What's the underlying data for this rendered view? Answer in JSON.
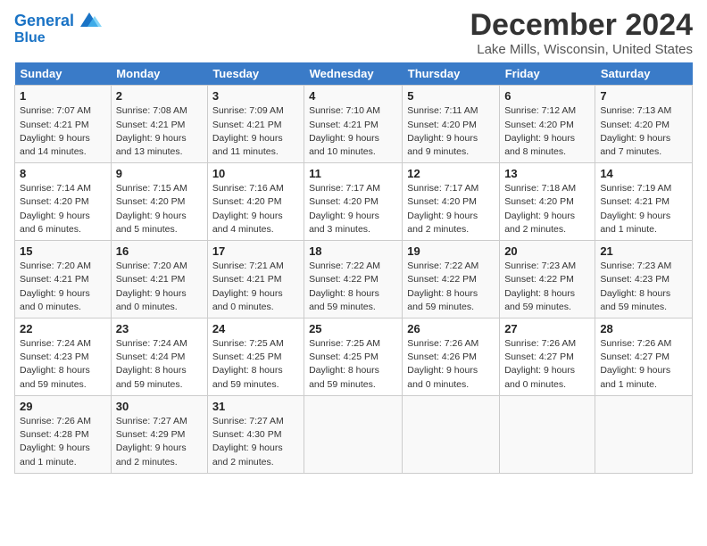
{
  "logo": {
    "line1": "General",
    "line2": "Blue"
  },
  "title": "December 2024",
  "location": "Lake Mills, Wisconsin, United States",
  "days_header": [
    "Sunday",
    "Monday",
    "Tuesday",
    "Wednesday",
    "Thursday",
    "Friday",
    "Saturday"
  ],
  "weeks": [
    [
      {
        "num": "1",
        "sunrise": "7:07 AM",
        "sunset": "4:21 PM",
        "daylight": "9 hours and 14 minutes."
      },
      {
        "num": "2",
        "sunrise": "7:08 AM",
        "sunset": "4:21 PM",
        "daylight": "9 hours and 13 minutes."
      },
      {
        "num": "3",
        "sunrise": "7:09 AM",
        "sunset": "4:21 PM",
        "daylight": "9 hours and 11 minutes."
      },
      {
        "num": "4",
        "sunrise": "7:10 AM",
        "sunset": "4:21 PM",
        "daylight": "9 hours and 10 minutes."
      },
      {
        "num": "5",
        "sunrise": "7:11 AM",
        "sunset": "4:20 PM",
        "daylight": "9 hours and 9 minutes."
      },
      {
        "num": "6",
        "sunrise": "7:12 AM",
        "sunset": "4:20 PM",
        "daylight": "9 hours and 8 minutes."
      },
      {
        "num": "7",
        "sunrise": "7:13 AM",
        "sunset": "4:20 PM",
        "daylight": "9 hours and 7 minutes."
      }
    ],
    [
      {
        "num": "8",
        "sunrise": "7:14 AM",
        "sunset": "4:20 PM",
        "daylight": "9 hours and 6 minutes."
      },
      {
        "num": "9",
        "sunrise": "7:15 AM",
        "sunset": "4:20 PM",
        "daylight": "9 hours and 5 minutes."
      },
      {
        "num": "10",
        "sunrise": "7:16 AM",
        "sunset": "4:20 PM",
        "daylight": "9 hours and 4 minutes."
      },
      {
        "num": "11",
        "sunrise": "7:17 AM",
        "sunset": "4:20 PM",
        "daylight": "9 hours and 3 minutes."
      },
      {
        "num": "12",
        "sunrise": "7:17 AM",
        "sunset": "4:20 PM",
        "daylight": "9 hours and 2 minutes."
      },
      {
        "num": "13",
        "sunrise": "7:18 AM",
        "sunset": "4:20 PM",
        "daylight": "9 hours and 2 minutes."
      },
      {
        "num": "14",
        "sunrise": "7:19 AM",
        "sunset": "4:21 PM",
        "daylight": "9 hours and 1 minute."
      }
    ],
    [
      {
        "num": "15",
        "sunrise": "7:20 AM",
        "sunset": "4:21 PM",
        "daylight": "9 hours and 0 minutes."
      },
      {
        "num": "16",
        "sunrise": "7:20 AM",
        "sunset": "4:21 PM",
        "daylight": "9 hours and 0 minutes."
      },
      {
        "num": "17",
        "sunrise": "7:21 AM",
        "sunset": "4:21 PM",
        "daylight": "9 hours and 0 minutes."
      },
      {
        "num": "18",
        "sunrise": "7:22 AM",
        "sunset": "4:22 PM",
        "daylight": "8 hours and 59 minutes."
      },
      {
        "num": "19",
        "sunrise": "7:22 AM",
        "sunset": "4:22 PM",
        "daylight": "8 hours and 59 minutes."
      },
      {
        "num": "20",
        "sunrise": "7:23 AM",
        "sunset": "4:22 PM",
        "daylight": "8 hours and 59 minutes."
      },
      {
        "num": "21",
        "sunrise": "7:23 AM",
        "sunset": "4:23 PM",
        "daylight": "8 hours and 59 minutes."
      }
    ],
    [
      {
        "num": "22",
        "sunrise": "7:24 AM",
        "sunset": "4:23 PM",
        "daylight": "8 hours and 59 minutes."
      },
      {
        "num": "23",
        "sunrise": "7:24 AM",
        "sunset": "4:24 PM",
        "daylight": "8 hours and 59 minutes."
      },
      {
        "num": "24",
        "sunrise": "7:25 AM",
        "sunset": "4:25 PM",
        "daylight": "8 hours and 59 minutes."
      },
      {
        "num": "25",
        "sunrise": "7:25 AM",
        "sunset": "4:25 PM",
        "daylight": "8 hours and 59 minutes."
      },
      {
        "num": "26",
        "sunrise": "7:26 AM",
        "sunset": "4:26 PM",
        "daylight": "9 hours and 0 minutes."
      },
      {
        "num": "27",
        "sunrise": "7:26 AM",
        "sunset": "4:27 PM",
        "daylight": "9 hours and 0 minutes."
      },
      {
        "num": "28",
        "sunrise": "7:26 AM",
        "sunset": "4:27 PM",
        "daylight": "9 hours and 1 minute."
      }
    ],
    [
      {
        "num": "29",
        "sunrise": "7:26 AM",
        "sunset": "4:28 PM",
        "daylight": "9 hours and 1 minute."
      },
      {
        "num": "30",
        "sunrise": "7:27 AM",
        "sunset": "4:29 PM",
        "daylight": "9 hours and 2 minutes."
      },
      {
        "num": "31",
        "sunrise": "7:27 AM",
        "sunset": "4:30 PM",
        "daylight": "9 hours and 2 minutes."
      },
      null,
      null,
      null,
      null
    ]
  ]
}
